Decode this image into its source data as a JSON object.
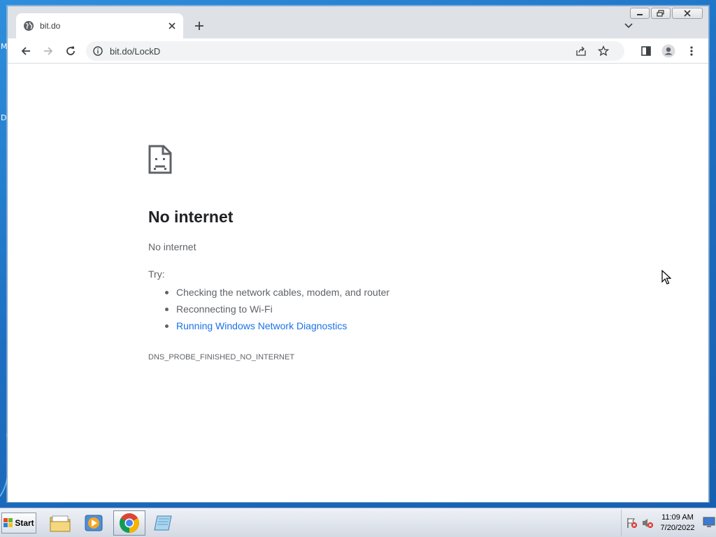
{
  "desktop": {
    "edge_texts": [
      "M",
      "D"
    ]
  },
  "browser": {
    "tab": {
      "title": "bit.do",
      "icon": "globe-icon"
    },
    "address_bar": {
      "url": "bit.do/LockD",
      "icon": "info-icon"
    },
    "toolbar_icons": [
      "back-arrow-icon",
      "forward-arrow-icon",
      "reload-icon",
      "share-icon",
      "star-icon",
      "side-panel-icon",
      "profile-icon",
      "kebab-menu-icon"
    ]
  },
  "error_page": {
    "title": "No internet",
    "subtitle": "No internet",
    "try_label": "Try:",
    "suggestions": [
      "Checking the network cables, modem, and router",
      "Reconnecting to Wi-Fi"
    ],
    "diagnostics_link": "Running Windows Network Diagnostics",
    "error_code": "DNS_PROBE_FINISHED_NO_INTERNET",
    "icon": "sad-document-icon"
  },
  "taskbar": {
    "start_label": "Start",
    "apps": [
      "file-explorer-icon",
      "media-player-icon",
      "chrome-icon",
      "notepad-icon"
    ],
    "clock": {
      "time": "11:09 AM",
      "date": "7/20/2022"
    }
  },
  "colors": {
    "link": "#1a73e8",
    "title_text": "#202124",
    "body_text": "#5f6368"
  }
}
